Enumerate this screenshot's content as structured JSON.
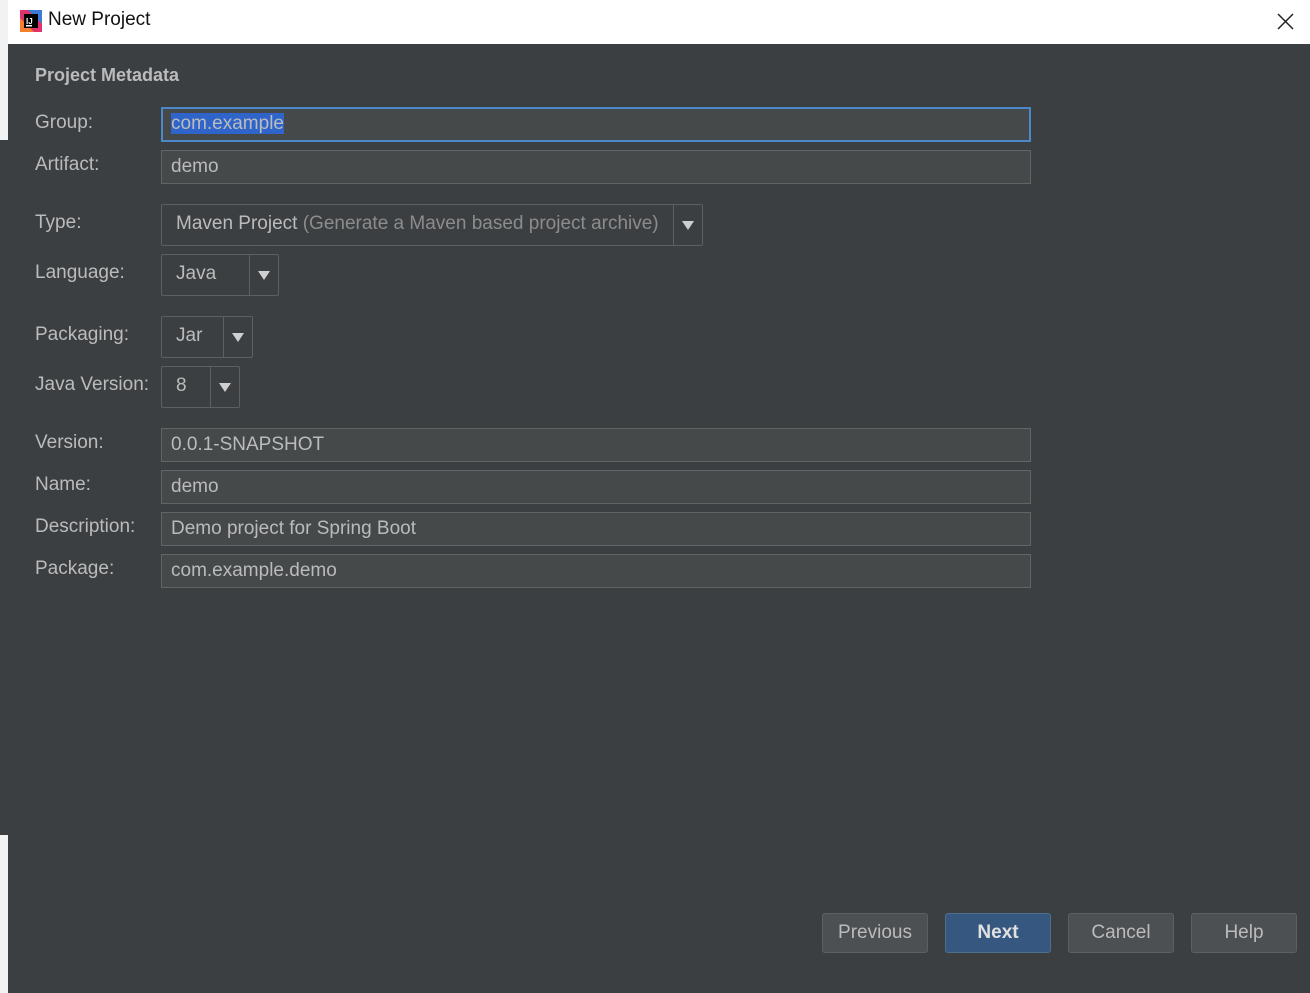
{
  "window": {
    "title": "New Project",
    "app_icon": "intellij-idea-icon",
    "close_icon": "close-icon"
  },
  "section": {
    "title": "Project Metadata"
  },
  "fields": {
    "group": {
      "label": "Group:",
      "value": "com.example"
    },
    "artifact": {
      "label": "Artifact:",
      "value": "demo"
    },
    "type": {
      "label": "Type:",
      "value": "Maven Project",
      "hint": " (Generate a Maven based project archive)"
    },
    "language": {
      "label": "Language:",
      "value": "Java"
    },
    "packaging": {
      "label": "Packaging:",
      "value": "Jar"
    },
    "java_version": {
      "label": "Java Version:",
      "value": "8"
    },
    "version": {
      "label": "Version:",
      "value": "0.0.1-SNAPSHOT"
    },
    "name": {
      "label": "Name:",
      "value": "demo"
    },
    "description": {
      "label": "Description:",
      "value": "Demo project for Spring Boot"
    },
    "package": {
      "label": "Package:",
      "value": "com.example.demo"
    }
  },
  "buttons": {
    "previous": "Previous",
    "next": "Next",
    "cancel": "Cancel",
    "help": "Help"
  },
  "colors": {
    "background": "#3c3f41",
    "field_background": "#45494a",
    "focus_border": "#4a88c7",
    "selection": "#2f65ca",
    "default_button": "#365880",
    "text": "#bbbbbb"
  }
}
